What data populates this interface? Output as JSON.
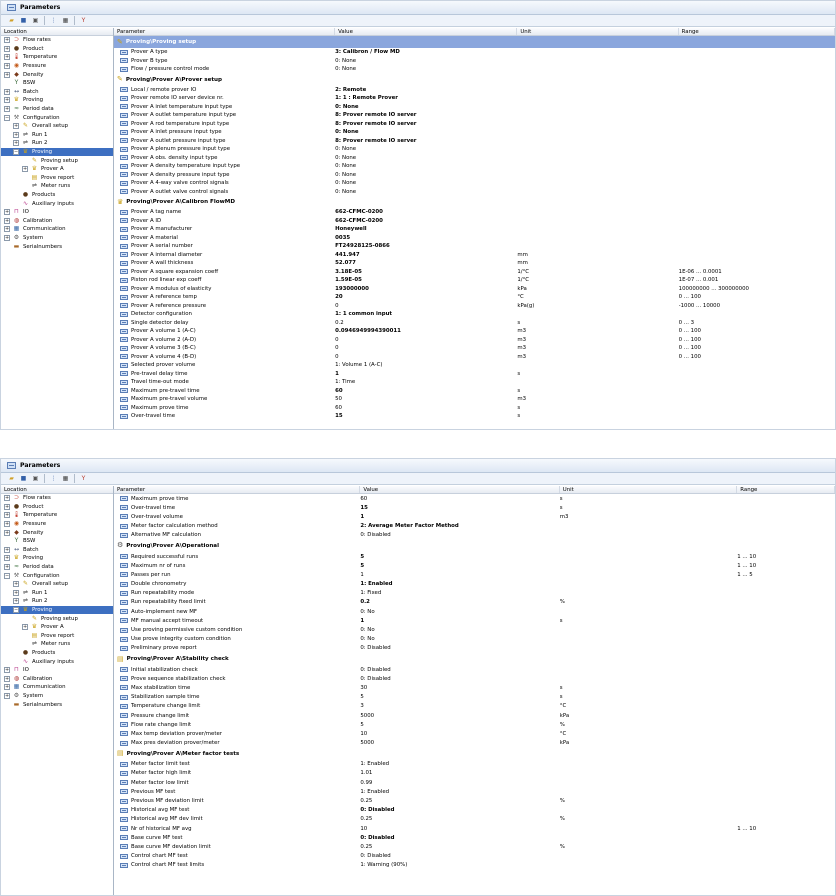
{
  "window_title": "Parameters",
  "columns": {
    "location": "Location",
    "parameter": "Parameter",
    "value": "Value",
    "unit": "Unit",
    "range": "Range"
  },
  "tree1": [
    {
      "label": "Flow rates",
      "level": 0,
      "exp": "+",
      "icon": "flow-icon",
      "glyph": "⊃",
      "cls": "c-flow"
    },
    {
      "label": "Product",
      "level": 0,
      "exp": "+",
      "icon": "product-drop-icon",
      "glyph": "●",
      "cls": "c-prod"
    },
    {
      "label": "Temperature",
      "level": 0,
      "exp": "+",
      "icon": "thermometer-icon",
      "glyph": "🌡",
      "cls": "c-temp"
    },
    {
      "label": "Pressure",
      "level": 0,
      "exp": "+",
      "icon": "pressure-gauge-icon",
      "glyph": "◉",
      "cls": "c-press"
    },
    {
      "label": "Density",
      "level": 0,
      "exp": "+",
      "icon": "density-icon",
      "glyph": "◆",
      "cls": "c-dens"
    },
    {
      "label": "BSW",
      "level": 0,
      "exp": "",
      "icon": "bsw-icon",
      "glyph": "Y",
      "cls": "c-bsw"
    },
    {
      "label": "Batch",
      "level": 0,
      "exp": "+",
      "icon": "batch-icon",
      "glyph": "↔",
      "cls": "c-batch"
    },
    {
      "label": "Proving",
      "level": 0,
      "exp": "+",
      "icon": "trophy-icon",
      "glyph": "♛",
      "cls": "c-prov"
    },
    {
      "label": "Period data",
      "level": 0,
      "exp": "+",
      "icon": "period-data-icon",
      "glyph": "≈",
      "cls": "c-period"
    },
    {
      "label": "Configuration",
      "level": 0,
      "exp": "−",
      "icon": "configuration-icon",
      "glyph": "⚒",
      "cls": "c-conf"
    },
    {
      "label": "Overall setup",
      "level": 1,
      "exp": "+",
      "icon": "setup-icon",
      "glyph": "✎",
      "cls": "c-prov"
    },
    {
      "label": "Run 1",
      "level": 1,
      "exp": "+",
      "icon": "run-icon",
      "glyph": "⇌",
      "cls": "c-run"
    },
    {
      "label": "Run 2",
      "level": 1,
      "exp": "+",
      "icon": "run-icon",
      "glyph": "⇌",
      "cls": "c-run"
    },
    {
      "label": "Proving",
      "level": 1,
      "exp": "−",
      "icon": "trophy-icon",
      "glyph": "♛",
      "cls": "c-prov",
      "selected": true
    },
    {
      "label": "Proving setup",
      "level": 2,
      "exp": "",
      "icon": "setup-icon",
      "glyph": "✎",
      "cls": "c-prov"
    },
    {
      "label": "Prover A",
      "level": 2,
      "exp": "+",
      "icon": "trophy-icon",
      "glyph": "♛",
      "cls": "c-prov"
    },
    {
      "label": "Prove report",
      "level": 2,
      "exp": "",
      "icon": "report-icon",
      "glyph": "▤",
      "cls": "c-prov"
    },
    {
      "label": "Meter runs",
      "level": 2,
      "exp": "",
      "icon": "meter-runs-icon",
      "glyph": "⇌",
      "cls": "c-run"
    },
    {
      "label": "Products",
      "level": 1,
      "exp": "",
      "icon": "product-drop-icon",
      "glyph": "●",
      "cls": "c-prod"
    },
    {
      "label": "Auxiliary inputs",
      "level": 1,
      "exp": "",
      "icon": "auxiliary-icon",
      "glyph": "∿",
      "cls": "c-aux"
    },
    {
      "label": "IO",
      "level": 0,
      "exp": "+",
      "icon": "io-icon",
      "glyph": "⊓",
      "cls": "c-io"
    },
    {
      "label": "Calibration",
      "level": 0,
      "exp": "+",
      "icon": "calibration-icon",
      "glyph": "◍",
      "cls": "c-cal"
    },
    {
      "label": "Communication",
      "level": 0,
      "exp": "+",
      "icon": "communication-icon",
      "glyph": "▦",
      "cls": "c-comm"
    },
    {
      "label": "System",
      "level": 0,
      "exp": "+",
      "icon": "gear-icon",
      "glyph": "⚙",
      "cls": "c-sys"
    },
    {
      "label": "Serialnumbers",
      "level": 0,
      "exp": "",
      "icon": "serialnumbers-icon",
      "glyph": "▬",
      "cls": "c-ser"
    }
  ],
  "grid1": [
    {
      "section": "Proving\\Proving setup",
      "icon": "setup-icon",
      "highlight": true
    },
    {
      "p": "Prover A type",
      "v": "3: Calibron / Flow MD",
      "b": true
    },
    {
      "p": "Prover B type",
      "v": "0: None"
    },
    {
      "p": "Flow / pressure control mode",
      "v": "0: None"
    },
    {
      "section": "Proving\\Prover A\\Prover setup",
      "icon": "setup-icon"
    },
    {
      "p": "Local / remote prover IO",
      "v": "2: Remote",
      "b": true
    },
    {
      "p": "Prover remote IO server device nr.",
      "v": "1: 1 : Remote Prover",
      "b": true
    },
    {
      "p": "Prover A inlet temperature input type",
      "v": "0: None",
      "b": true
    },
    {
      "p": "Prover A outlet temperature input type",
      "v": "8: Prover remote IO server",
      "b": true
    },
    {
      "p": "Prover A rod temperature input type",
      "v": "8: Prover remote IO server",
      "b": true
    },
    {
      "p": "Prover A inlet pressure input type",
      "v": "0: None",
      "b": true
    },
    {
      "p": "Prover A outlet pressure input type",
      "v": "8: Prover remote IO server",
      "b": true
    },
    {
      "p": "Prover A plenum pressure input type",
      "v": "0: None"
    },
    {
      "p": "Prover A obs. density input type",
      "v": "0: None"
    },
    {
      "p": "Prover A density temperature input type",
      "v": "0: None"
    },
    {
      "p": "Prover A density pressure input type",
      "v": "0: None"
    },
    {
      "p": "Prover A 4-way valve control signals",
      "v": "0: None"
    },
    {
      "p": "Prover A outlet valve control signals",
      "v": "0: None"
    },
    {
      "section": "Proving\\Prover A\\Calibron FlowMD",
      "icon": "trophy-icon"
    },
    {
      "p": "Prover A tag name",
      "v": "662-CFMC-0200",
      "b": true
    },
    {
      "p": "Prover A ID",
      "v": "662-CFMC-0200",
      "b": true
    },
    {
      "p": "Prover A manufacturer",
      "v": "Honeywell",
      "b": true
    },
    {
      "p": "Prover A material",
      "v": "0035",
      "b": true
    },
    {
      "p": "Prover A serial number",
      "v": "FT24928125-0866",
      "b": true
    },
    {
      "p": "Prover A internal diameter",
      "v": "441.947",
      "b": true,
      "u": "mm"
    },
    {
      "p": "Prover A wall thickness",
      "v": "52.077",
      "b": true,
      "u": "mm"
    },
    {
      "p": "Prover A square expansion coeff",
      "v": "3.18E-05",
      "b": true,
      "u": "1/°C",
      "r": "1E-06 ... 0.0001"
    },
    {
      "p": "Piston rod linear exp coeff",
      "v": "1.59E-05",
      "b": true,
      "u": "1/°C",
      "r": "1E-07 ... 0.001"
    },
    {
      "p": "Prover A modulus of elasticity",
      "v": "193000000",
      "b": true,
      "u": "kPa",
      "r": "100000000 ... 300000000"
    },
    {
      "p": "Prover A reference temp",
      "v": "20",
      "b": true,
      "u": "°C",
      "r": "0 ... 100"
    },
    {
      "p": "Prover A reference pressure",
      "v": "0",
      "u": "kPa(g)",
      "r": "-1000 ... 10000"
    },
    {
      "p": "Detector configuration",
      "v": "1: 1 common input",
      "b": true
    },
    {
      "p": "Single detector delay",
      "v": "0.2",
      "u": "s",
      "r": "0 ... 3"
    },
    {
      "p": "Prover A volume 1 (A-C)",
      "v": "0.0946949994390011",
      "b": true,
      "u": "m3",
      "r": "0 ... 100"
    },
    {
      "p": "Prover A volume 2 (A-D)",
      "v": "0",
      "u": "m3",
      "r": "0 ... 100"
    },
    {
      "p": "Prover A volume 3 (B-C)",
      "v": "0",
      "u": "m3",
      "r": "0 ... 100"
    },
    {
      "p": "Prover A volume 4 (B-D)",
      "v": "0",
      "u": "m3",
      "r": "0 ... 100"
    },
    {
      "p": "Selected prover volume",
      "v": "1: Volume 1 (A-C)"
    },
    {
      "p": "Pre-travel delay time",
      "v": "1",
      "b": true,
      "u": "s"
    },
    {
      "p": "Travel time-out mode",
      "v": "1: Time"
    },
    {
      "p": "Maximum pre-travel time",
      "v": "60",
      "b": true,
      "u": "s"
    },
    {
      "p": "Maximum pre-travel volume",
      "v": "50",
      "u": "m3"
    },
    {
      "p": "Maximum prove time",
      "v": "60",
      "u": "s"
    },
    {
      "p": "Over-travel time",
      "v": "15",
      "b": true,
      "u": "s"
    }
  ],
  "grid2": [
    {
      "p": "Maximum prove time",
      "v": "60",
      "u": "s"
    },
    {
      "p": "Over-travel time",
      "v": "15",
      "b": true,
      "u": "s"
    },
    {
      "p": "Over-travel volume",
      "v": "1",
      "b": true,
      "u": "m3"
    },
    {
      "p": "Meter factor calculation method",
      "v": "2: Average Meter Factor Method",
      "b": true
    },
    {
      "p": "Alternative MF calculation",
      "v": "0: Disabled"
    },
    {
      "section": "Proving\\Prover A\\Operational",
      "icon": "gear-icon"
    },
    {
      "p": "Required successful runs",
      "v": "5",
      "b": true,
      "r": "1 ... 10"
    },
    {
      "p": "Maximum nr of runs",
      "v": "5",
      "b": true,
      "r": "1 ... 10"
    },
    {
      "p": "Passes per run",
      "v": "1",
      "r": "1 ... 5"
    },
    {
      "p": "Double chronometry",
      "v": "1: Enabled",
      "b": true
    },
    {
      "p": "Run repeatability mode",
      "v": "1: Fixed"
    },
    {
      "p": "Run repeatability fixed limit",
      "v": "0.2",
      "b": true,
      "u": "%"
    },
    {
      "p": "Auto-implement new MF",
      "v": "0: No"
    },
    {
      "p": "MF manual accept timeout",
      "v": "1",
      "b": true,
      "u": "s"
    },
    {
      "p": "Use proving permissive custom condition",
      "v": "0: No"
    },
    {
      "p": "Use prove integrity custom condition",
      "v": "0: No"
    },
    {
      "p": "Preliminary prove report",
      "v": "0: Disabled"
    },
    {
      "section": "Proving\\Prover A\\Stability check",
      "icon": "report-icon"
    },
    {
      "p": "Initial stabilization check",
      "v": "0: Disabled"
    },
    {
      "p": "Prove sequence stabilization check",
      "v": "0: Disabled"
    },
    {
      "p": "Max stabilization time",
      "v": "30",
      "u": "s"
    },
    {
      "p": "Stabilization sample time",
      "v": "5",
      "u": "s"
    },
    {
      "p": "Temperature change limit",
      "v": "3",
      "u": "°C"
    },
    {
      "p": "Pressure change limit",
      "v": "5000",
      "u": "kPa"
    },
    {
      "p": "Flow rate change limit",
      "v": "5",
      "u": "%"
    },
    {
      "p": "Max temp deviation prover/meter",
      "v": "10",
      "u": "°C"
    },
    {
      "p": "Max pres deviation prover/meter",
      "v": "5000",
      "u": "kPa"
    },
    {
      "section": "Proving\\Prover A\\Meter factor tests",
      "icon": "report-icon"
    },
    {
      "p": "Meter factor limit test",
      "v": "1: Enabled"
    },
    {
      "p": "Meter factor high limit",
      "v": "1.01"
    },
    {
      "p": "Meter factor low limit",
      "v": "0.99"
    },
    {
      "p": "Previous MF test",
      "v": "1: Enabled"
    },
    {
      "p": "Previous MF deviation limit",
      "v": "0.25",
      "u": "%"
    },
    {
      "p": "Historical avg MF test",
      "v": "0: Disabled",
      "b": true
    },
    {
      "p": "Historical avg MF dev limit",
      "v": "0.25",
      "u": "%"
    },
    {
      "p": "Nr of historical MF avg",
      "v": "10",
      "r": "1 ... 10"
    },
    {
      "p": "Base curve MF test",
      "v": "0: Disabled",
      "b": true
    },
    {
      "p": "Base curve MF deviation limit",
      "v": "0.25",
      "u": "%"
    },
    {
      "p": "Control chart MF test",
      "v": "0: Disabled"
    },
    {
      "p": "Control chart MF test limits",
      "v": "1: Warning (90%)"
    }
  ],
  "colors": {
    "selected": "#3d6fc1",
    "section_highlight": "#8aa6dd",
    "titlebar": "#dde7f4"
  }
}
